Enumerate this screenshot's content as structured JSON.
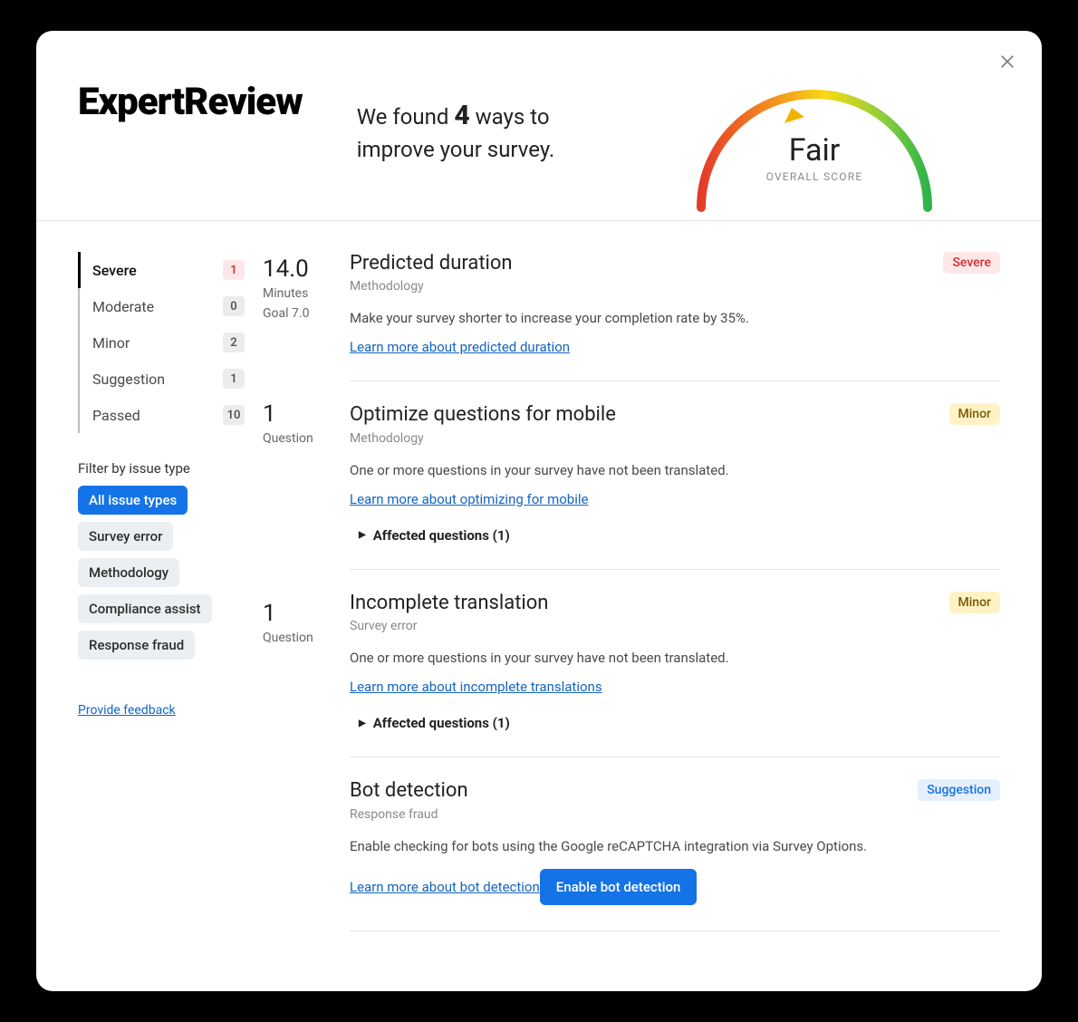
{
  "brand": "ExpertReview",
  "summary": {
    "prefix": "We found ",
    "count": "4",
    "suffix": " ways to improve your survey."
  },
  "gauge": {
    "score_label": "Fair",
    "caption": "OVERALL SCORE"
  },
  "severity": [
    {
      "label": "Severe",
      "count": "1",
      "active": true,
      "style": "severe"
    },
    {
      "label": "Moderate",
      "count": "0",
      "active": false,
      "style": ""
    },
    {
      "label": "Minor",
      "count": "2",
      "active": false,
      "style": ""
    },
    {
      "label": "Suggestion",
      "count": "1",
      "active": false,
      "style": ""
    },
    {
      "label": "Passed",
      "count": "10",
      "active": false,
      "style": ""
    }
  ],
  "filter": {
    "title": "Filter by issue type",
    "chips": [
      {
        "label": "All issue types",
        "active": true
      },
      {
        "label": "Survey error",
        "active": false
      },
      {
        "label": "Methodology",
        "active": false
      },
      {
        "label": "Compliance assist",
        "active": false
      },
      {
        "label": "Response fraud",
        "active": false
      }
    ]
  },
  "feedback_link": "Provide feedback",
  "issues": [
    {
      "metric": {
        "value": "14.0",
        "unit": "Minutes",
        "goal": "Goal 7.0"
      },
      "title": "Predicted duration",
      "category": "Methodology",
      "badge": "Severe",
      "badge_class": "severe",
      "description": "Make your survey shorter to increase your completion rate by 35%.",
      "link": "Learn more about predicted duration",
      "affected": "",
      "action": ""
    },
    {
      "metric": {
        "value": "1",
        "unit": "Question",
        "goal": ""
      },
      "title": "Optimize questions for mobile",
      "category": "Methodology",
      "badge": "Minor",
      "badge_class": "minor",
      "description": "One or more questions in your survey have not been translated.",
      "link": "Learn more about optimizing for mobile",
      "affected": "Affected questions (1)",
      "action": ""
    },
    {
      "metric": {
        "value": "1",
        "unit": "Question",
        "goal": ""
      },
      "title": "Incomplete translation",
      "category": "Survey error",
      "badge": "Minor",
      "badge_class": "minor",
      "description": "One or more questions in your survey have not been translated.",
      "link": "Learn more about incomplete translations",
      "affected": "Affected questions (1)",
      "action": ""
    },
    {
      "metric": {
        "value": "",
        "unit": "",
        "goal": ""
      },
      "title": "Bot detection",
      "category": "Response fraud",
      "badge": "Suggestion",
      "badge_class": "suggestion",
      "description": "Enable checking for bots using the Google reCAPTCHA integration via Survey Options.",
      "link": "Learn more about bot detection",
      "affected": "",
      "action": "Enable bot detection"
    }
  ]
}
